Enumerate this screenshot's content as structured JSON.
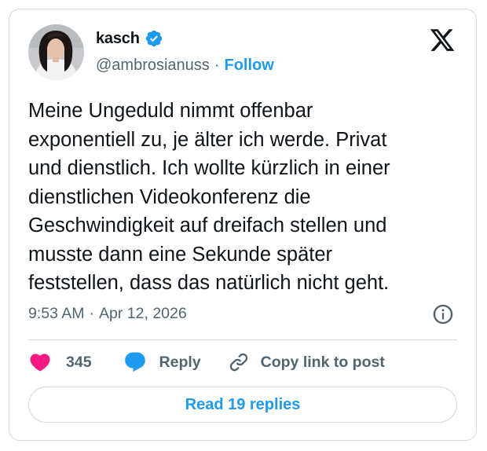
{
  "author": {
    "display_name": "kasch",
    "handle": "@ambrosianuss",
    "separator": "·",
    "follow_label": "Follow",
    "verified": true
  },
  "tweet": {
    "text": "Meine Ungeduld nimmt offenbar\nexponentiell zu, je älter ich werde. Privat\nund dienstlich. Ich wollte kürzlich in einer\ndienstlichen Videokonferenz die\nGeschwindigkeit auf dreifach stellen und\nmusste dann eine Sekunde später\nfeststellen, dass das natürlich nicht geht.",
    "time": "9:53 AM",
    "separator": "·",
    "date": "Apr 12, 2026"
  },
  "actions": {
    "like_count": "345",
    "reply_label": "Reply",
    "copy_label": "Copy link to post"
  },
  "read_replies_label": "Read 19 replies",
  "icons": {
    "logo": "x-logo-icon",
    "verified": "verified-badge-icon",
    "info": "info-icon",
    "like": "heart-icon",
    "reply": "speech-bubble-icon",
    "copy": "link-icon"
  },
  "colors": {
    "accent": "#1d9bf0",
    "like": "#f91880",
    "text": "#0f1419",
    "secondary": "#536471",
    "border": "#cfd9de"
  }
}
